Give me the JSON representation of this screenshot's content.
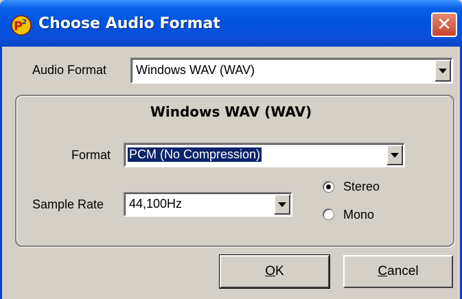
{
  "window": {
    "title": "Choose Audio Format",
    "close_symbol": "✕"
  },
  "audio_format": {
    "label": "Audio Format",
    "value": "Windows WAV (WAV)"
  },
  "group": {
    "title": "Windows WAV (WAV)",
    "format_label": "Format",
    "format_value": "PCM (No Compression)",
    "sample_rate_label": "Sample Rate",
    "sample_rate_value": "44,100Hz",
    "channels": [
      {
        "label": "Stereo",
        "selected": true
      },
      {
        "label": "Mono",
        "selected": false
      }
    ]
  },
  "buttons": {
    "ok_mnemonic": "O",
    "ok_rest": "K",
    "cancel_mnemonic": "C",
    "cancel_rest": "ancel"
  },
  "colors": {
    "titlebar": "#0052e0",
    "dialog_bg": "#d4d0c8",
    "selection": "#0a246a",
    "close_button": "#c8432a"
  }
}
